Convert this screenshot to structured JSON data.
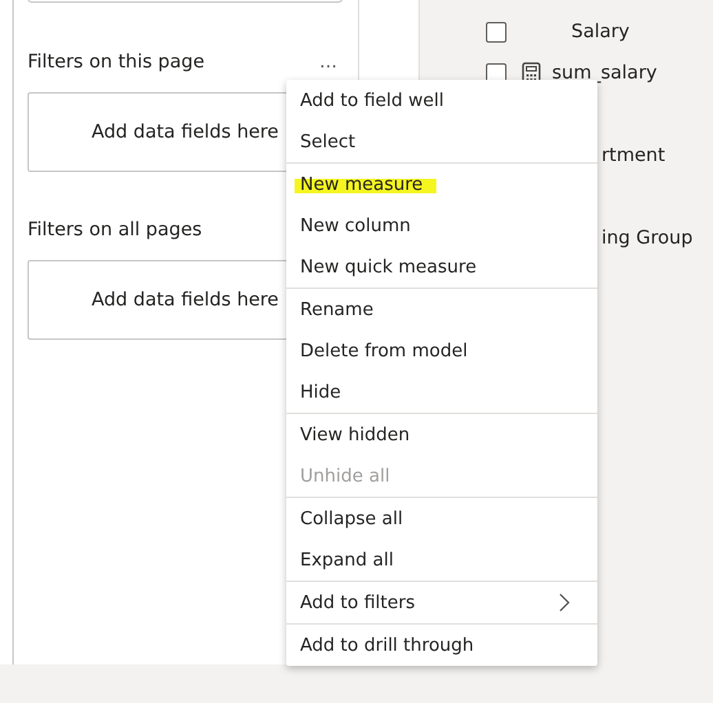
{
  "filter_pane": {
    "sections": [
      {
        "title": "Filters on this page",
        "more": "…",
        "dropzone": "Add data fields here"
      },
      {
        "title": "Filters on all pages",
        "dropzone": "Add data fields here"
      }
    ]
  },
  "fields": [
    {
      "label": "Salary",
      "checked": false,
      "kind": "plain"
    },
    {
      "label": "sum_salary",
      "checked": false,
      "kind": "measure"
    },
    {
      "kind": "hidden"
    },
    {
      "label": "rtment",
      "kind": "covered"
    },
    {
      "kind": "hidden"
    },
    {
      "label": "ing Group",
      "kind": "covered"
    }
  ],
  "context_menu": {
    "groups": [
      [
        {
          "label": "Add to field well",
          "disabled": false,
          "highlighted": false
        },
        {
          "label": "Select",
          "disabled": false,
          "highlighted": false
        }
      ],
      [
        {
          "label": "New measure",
          "disabled": false,
          "highlighted": true
        },
        {
          "label": "New column",
          "disabled": false,
          "highlighted": false
        },
        {
          "label": "New quick measure",
          "disabled": false,
          "highlighted": false
        }
      ],
      [
        {
          "label": "Rename",
          "disabled": false,
          "highlighted": false
        },
        {
          "label": "Delete from model",
          "disabled": false,
          "highlighted": false
        },
        {
          "label": "Hide",
          "disabled": false,
          "highlighted": false
        }
      ],
      [
        {
          "label": "View hidden",
          "disabled": false,
          "highlighted": false
        },
        {
          "label": "Unhide all",
          "disabled": true,
          "highlighted": false
        }
      ],
      [
        {
          "label": "Collapse all",
          "disabled": false,
          "highlighted": false
        },
        {
          "label": "Expand all",
          "disabled": false,
          "highlighted": false
        }
      ],
      [
        {
          "label": "Add to filters",
          "disabled": false,
          "highlighted": false,
          "submenu": true
        }
      ],
      [
        {
          "label": "Add to drill through",
          "disabled": false,
          "highlighted": false
        }
      ]
    ]
  }
}
